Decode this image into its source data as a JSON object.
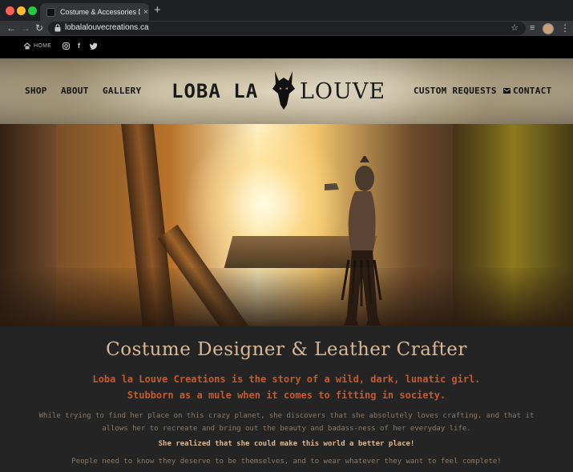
{
  "browser": {
    "tab_title": "Costume & Accessories Design",
    "tab_close": "×",
    "new_tab": "+",
    "url": "lobalalouvecreations.ca"
  },
  "topbar": {
    "home_label": "HOME",
    "facebook_glyph": "f"
  },
  "nav": {
    "shop": "SHOP",
    "about": "ABOUT",
    "gallery": "GALLERY",
    "custom_requests": "CUSTOM REQUESTS",
    "contact": "CONTACT"
  },
  "logo": {
    "part1": "LOBA LA",
    "part2": "LOUVE"
  },
  "content": {
    "title": "Costume Designer & Leather Crafter",
    "tagline_1": "Loba la Louve Creations is the story of a wild, dark, lunatic girl.",
    "tagline_2": "Stubborn as a mule when it comes to fitting in society.",
    "paragraph_1": "While trying to find her place on this crazy planet, she discovers that she absolutely loves crafting, and that it allows her to recreate and bring out the beauty and badass-ness of her everyday life.",
    "paragraph_2": "She realized that she could make this world a better place!",
    "paragraph_3": "People need to know they deserve to be themselves, and to wear whatever they want to feel complete!"
  },
  "colors": {
    "title": "#d9b896",
    "tagline": "#c45a2e",
    "body": "#8a7a6a",
    "background": "#242424"
  },
  "icons": [
    "home-icon",
    "instagram-icon",
    "facebook-icon",
    "twitter-icon",
    "envelope-icon",
    "lock-icon",
    "star-icon",
    "wolf-logo-icon"
  ]
}
